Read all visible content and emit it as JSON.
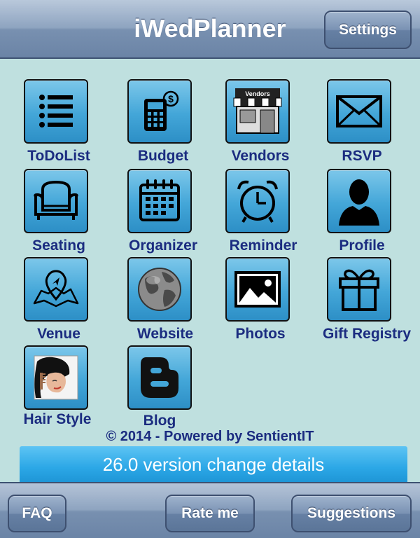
{
  "header": {
    "title": "iWedPlanner",
    "settings_label": "Settings"
  },
  "grid": {
    "items": [
      {
        "label": "ToDoList",
        "icon": "list-icon"
      },
      {
        "label": "Budget",
        "icon": "calculator-icon"
      },
      {
        "label": "Vendors",
        "icon": "storefront-icon",
        "sign": "Vendors"
      },
      {
        "label": "RSVP",
        "icon": "envelope-icon"
      },
      {
        "label": "Seating",
        "icon": "armchair-icon"
      },
      {
        "label": "Organizer",
        "icon": "calendar-icon"
      },
      {
        "label": "Reminder",
        "icon": "alarm-clock-icon"
      },
      {
        "label": "Profile",
        "icon": "person-silhouette-icon"
      },
      {
        "label": "Venue",
        "icon": "map-pin-icon"
      },
      {
        "label": "Website",
        "icon": "globe-icon"
      },
      {
        "label": "Photos",
        "icon": "picture-icon"
      },
      {
        "label": "Gift Registry",
        "icon": "gift-icon"
      },
      {
        "label": "Hair Style",
        "icon": "hair-style-icon"
      },
      {
        "label": "Blog",
        "icon": "blogger-icon"
      }
    ]
  },
  "footer": {
    "copyright": "© 2014 - Powered by SentientIT",
    "version_text": "26.0 version change details"
  },
  "toolbar": {
    "faq_label": "FAQ",
    "rate_label": "Rate me",
    "suggestions_label": "Suggestions"
  },
  "colors": {
    "label": "#1b2c80",
    "tile": "#43a6d8",
    "background": "#bfe0df",
    "bar": "#7890b0"
  }
}
